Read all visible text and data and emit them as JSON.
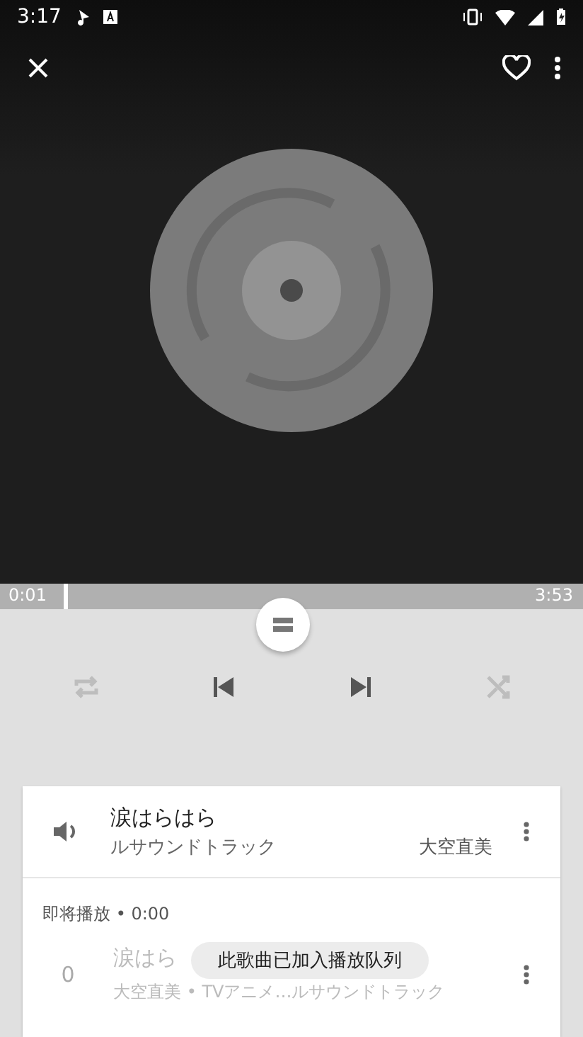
{
  "status_bar": {
    "time": "3:17"
  },
  "player": {
    "favorite": false
  },
  "seek": {
    "elapsed": "0:01",
    "duration": "3:53",
    "level": 0.11
  },
  "controls": {
    "repeat": {
      "on": false
    },
    "shuffle": {
      "on": false
    }
  },
  "now_playing": {
    "title": "涙はらはら",
    "subtitle": "ルサウンドトラック",
    "artist": "大空直美"
  },
  "queue": {
    "header": "即将播放 • 0:00",
    "items": [
      {
        "number": "0",
        "title": "涙はら",
        "subtitle": "大空直美 • TVアニメ…ルサウンドトラック"
      }
    ]
  },
  "toast": "此歌曲已加入播放队列"
}
